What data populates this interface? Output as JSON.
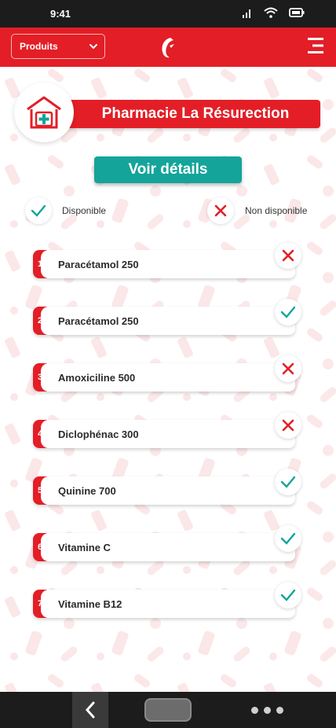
{
  "status_bar": {
    "time": "9:41"
  },
  "app_bar": {
    "dropdown_label": "Produits"
  },
  "pharmacy": {
    "name": "Pharmacie La Résurection"
  },
  "details_button": "Voir détails",
  "legend": {
    "available": "Disponible",
    "unavailable": "Non disponible"
  },
  "colors": {
    "brand_red": "#e31e26",
    "teal": "#14a49a"
  },
  "products": [
    {
      "number": "1",
      "name": "Paracétamol 250",
      "available": false
    },
    {
      "number": "2",
      "name": "Paracétamol 250",
      "available": true
    },
    {
      "number": "3",
      "name": "Amoxiciline 500",
      "available": false
    },
    {
      "number": "4",
      "name": "Diclophénac 300",
      "available": false
    },
    {
      "number": "5",
      "name": "Quinine 700",
      "available": true
    },
    {
      "number": "6",
      "name": "Vitamine C",
      "available": true
    },
    {
      "number": "7",
      "name": "Vitamine B12",
      "available": true
    }
  ]
}
